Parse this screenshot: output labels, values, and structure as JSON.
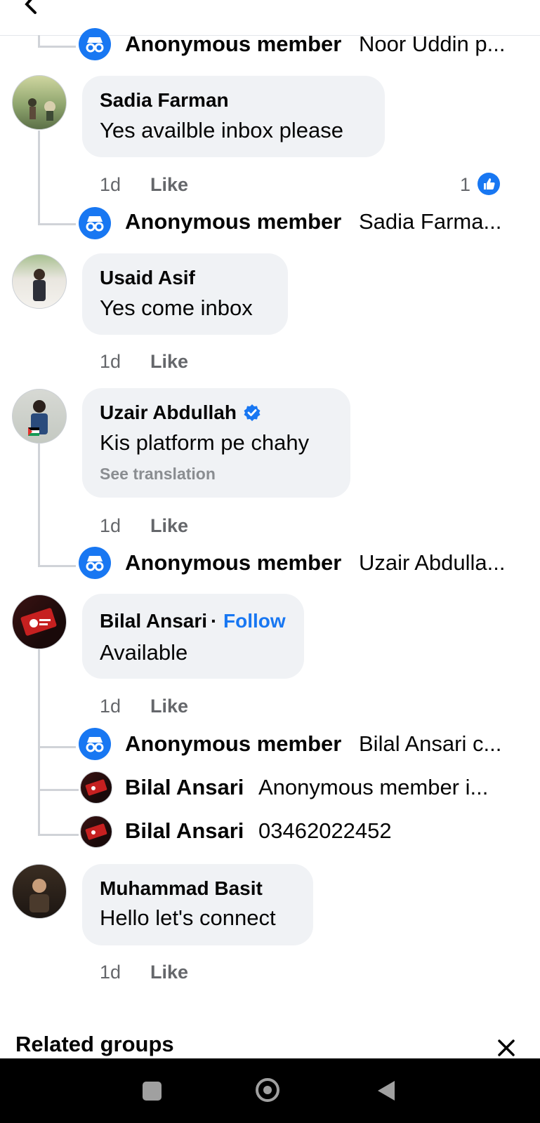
{
  "header": {
    "back_icon": "chevron-left-icon"
  },
  "top_reply": {
    "name": "Anonymous member",
    "text": "Noor Uddin p..."
  },
  "comments": [
    {
      "author": "Sadia Farman",
      "text": "Yes availble inbox please",
      "time": "1d",
      "like": "Like",
      "reaction_count": "1",
      "reply": {
        "name": "Anonymous member",
        "text": "Sadia Farma..."
      }
    },
    {
      "author": "Usaid Asif",
      "text": "Yes come inbox",
      "time": "1d",
      "like": "Like"
    },
    {
      "author": "Uzair Abdullah",
      "text": "Kis platform pe chahy",
      "see_translation": "See translation",
      "time": "1d",
      "like": "Like",
      "reply": {
        "name": "Anonymous member",
        "text": "Uzair Abdulla..."
      }
    },
    {
      "author": "Bilal Ansari",
      "separator": "·",
      "follow": "Follow",
      "text": "Available",
      "time": "1d",
      "like": "Like",
      "replies": [
        {
          "name": "Anonymous member",
          "text": "Bilal Ansari c..."
        },
        {
          "name": "Bilal Ansari",
          "text": "Anonymous member i..."
        },
        {
          "name": "Bilal Ansari",
          "text": "03462022452"
        }
      ]
    },
    {
      "author": "Muhammad Basit",
      "text": "Hello let's connect",
      "time": "1d",
      "like": "Like"
    }
  ],
  "related": {
    "title": "Related groups"
  },
  "colors": {
    "accent": "#1877f2",
    "bubble": "#f0f2f5",
    "meta": "#65676b"
  }
}
